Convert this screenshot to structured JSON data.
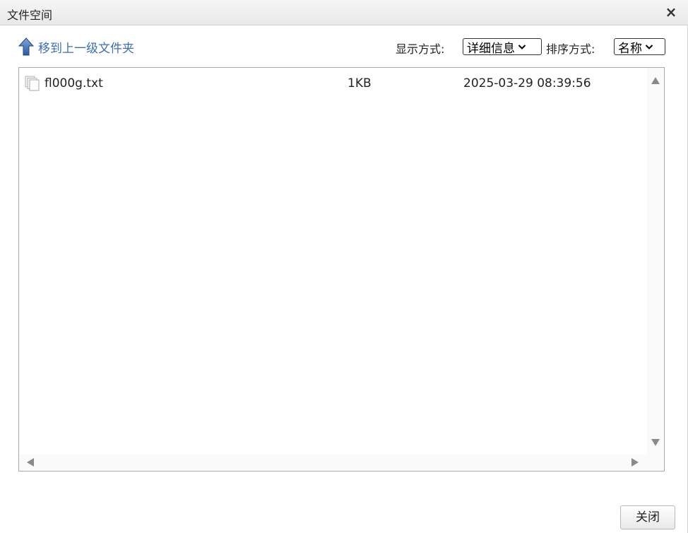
{
  "window": {
    "title": "文件空间",
    "close_glyph": "×"
  },
  "toolbar": {
    "up_folder_label": "移到上一级文件夹",
    "up_icon": "arrow-up-icon",
    "display_mode_label": "显示方式:",
    "display_mode_value": "详细信息",
    "sort_label": "排序方式:",
    "sort_value": "名称"
  },
  "files": [
    {
      "name": "fl000g.txt",
      "size": "1KB",
      "modified": "2025-03-29 08:39:56",
      "icon": "file-icon"
    }
  ],
  "footer": {
    "close_button_label": "关闭"
  },
  "colors": {
    "link": "#3c6fb4",
    "titlebar": "#efefef",
    "border": "#a9a9a9"
  }
}
